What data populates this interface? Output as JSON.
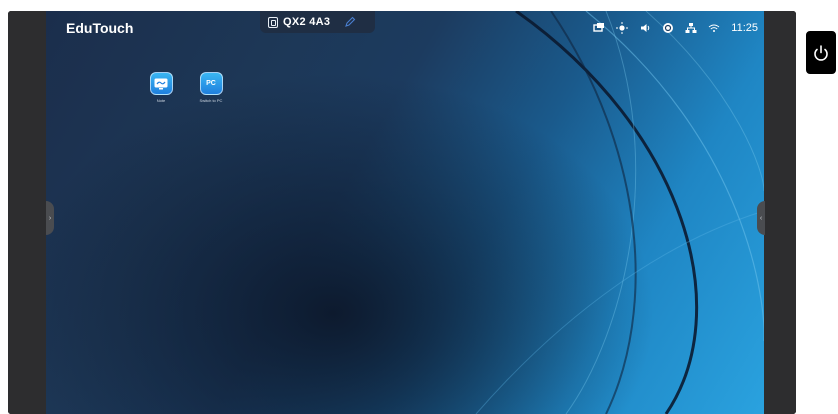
{
  "desktop": {
    "brand": "EduTouch",
    "session_code": "QX2 4A3",
    "clock": "11:25"
  },
  "status_icons": [
    "screen-share-icon",
    "brightness-icon",
    "volume-icon",
    "network-hub-icon",
    "ethernet-icon",
    "wifi-icon"
  ],
  "apps": [
    {
      "label": "Note",
      "icon": "note-app-icon"
    },
    {
      "label": "Switch to PC",
      "icon": "pc-app-icon",
      "glyph": "PC"
    }
  ],
  "colors": {
    "accent": "#2aa2df",
    "bar": "#1f2e44",
    "bezel": "#2d2d2f"
  }
}
